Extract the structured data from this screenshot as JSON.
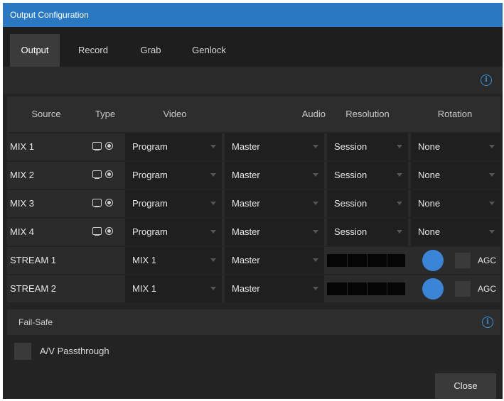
{
  "window": {
    "title": "Output Configuration"
  },
  "tabs": [
    {
      "label": "Output",
      "active": true
    },
    {
      "label": "Record",
      "active": false
    },
    {
      "label": "Grab",
      "active": false
    },
    {
      "label": "Genlock",
      "active": false
    }
  ],
  "info_icon_glyph": "i",
  "table": {
    "headers": [
      "Source",
      "Type",
      "Video",
      "Audio",
      "Resolution",
      "Rotation"
    ],
    "mix_rows": [
      {
        "source": "MIX 1",
        "video": "Program",
        "audio": "Master",
        "resolution": "Session",
        "rotation": "None"
      },
      {
        "source": "MIX 2",
        "video": "Program",
        "audio": "Master",
        "resolution": "Session",
        "rotation": "None"
      },
      {
        "source": "MIX 3",
        "video": "Program",
        "audio": "Master",
        "resolution": "Session",
        "rotation": "None"
      },
      {
        "source": "MIX 4",
        "video": "Program",
        "audio": "Master",
        "resolution": "Session",
        "rotation": "None"
      }
    ],
    "stream_rows": [
      {
        "source": "STREAM 1",
        "video": "MIX 1",
        "audio": "Master",
        "agc_label": "AGC"
      },
      {
        "source": "STREAM 2",
        "video": "MIX 1",
        "audio": "Master",
        "agc_label": "AGC"
      }
    ],
    "type_icons": [
      "monitor-icon",
      "record-icon"
    ]
  },
  "failsafe": {
    "title": "Fail-Safe",
    "passthrough_label": "A/V Passthrough"
  },
  "footer": {
    "close_label": "Close"
  },
  "colors": {
    "titlebar": "#2a78c2",
    "accent": "#3b85d8"
  }
}
